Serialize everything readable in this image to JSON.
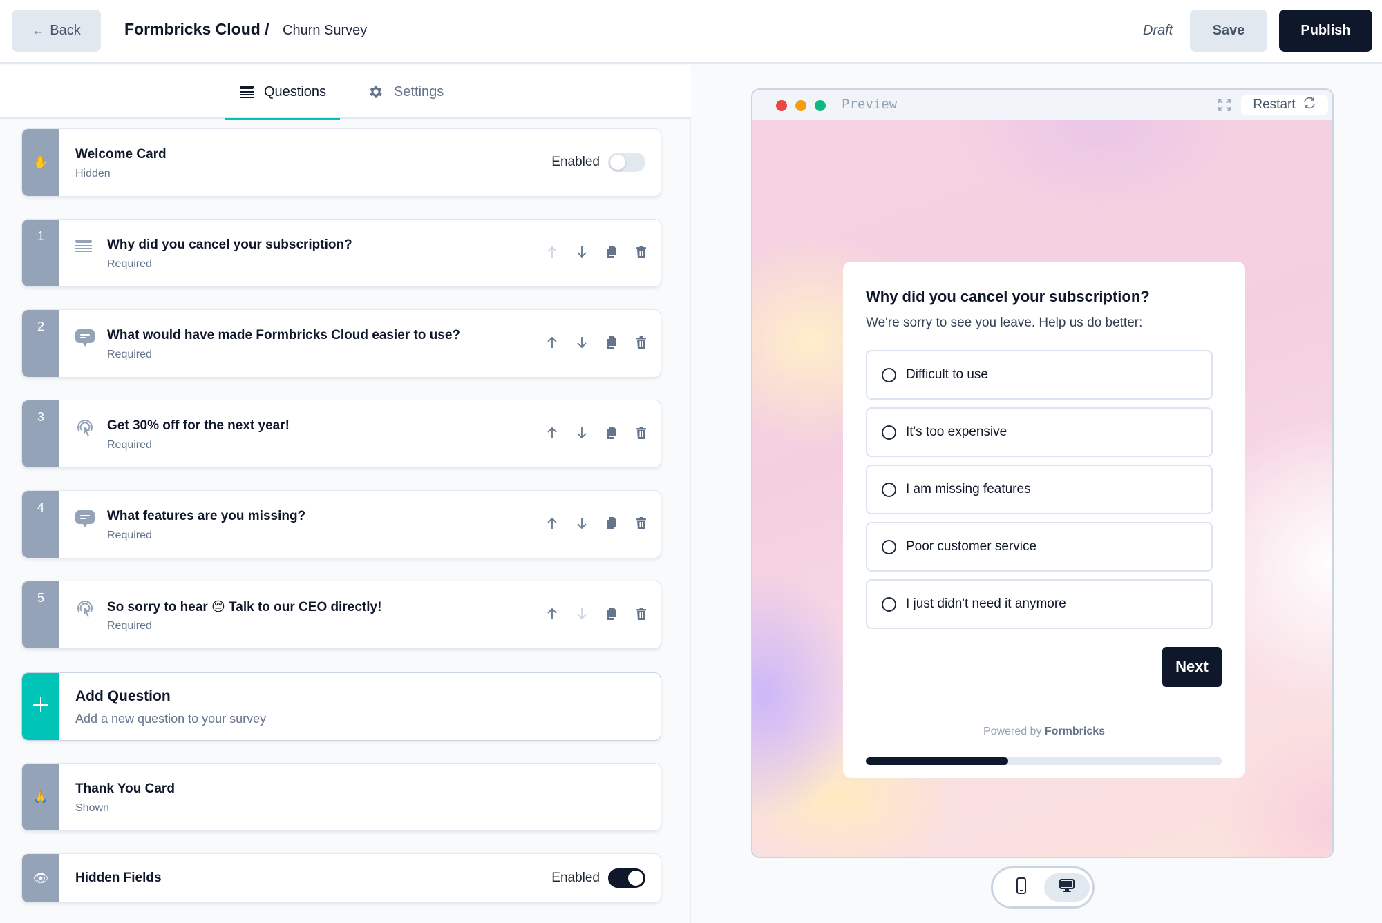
{
  "header": {
    "back_label": "Back",
    "brand": "Formbricks Cloud /",
    "survey_name": "Churn Survey",
    "status": "Draft",
    "save_label": "Save",
    "publish_label": "Publish"
  },
  "tabs": [
    {
      "label": "Questions",
      "icon": "list-icon",
      "active": true
    },
    {
      "label": "Settings",
      "icon": "gear-icon",
      "active": false
    }
  ],
  "welcome_card": {
    "icon": "✋",
    "title": "Welcome Card",
    "status": "Hidden",
    "toggle_label": "Enabled",
    "enabled": false
  },
  "questions": [
    {
      "number": "1",
      "type_icon": "list-lines-icon",
      "title": "Why did you cancel your subscription?",
      "status": "Required",
      "can_move_up": false,
      "can_move_down": true
    },
    {
      "number": "2",
      "type_icon": "chat-bubble-icon",
      "title": "What would have made Formbricks Cloud easier to use?",
      "status": "Required",
      "can_move_up": true,
      "can_move_down": true
    },
    {
      "number": "3",
      "type_icon": "cursor-click-icon",
      "title": "Get 30% off for the next year!",
      "status": "Required",
      "can_move_up": true,
      "can_move_down": true
    },
    {
      "number": "4",
      "type_icon": "chat-bubble-icon",
      "title": "What features are you missing?",
      "status": "Required",
      "can_move_up": true,
      "can_move_down": true
    },
    {
      "number": "5",
      "type_icon": "cursor-click-icon",
      "title": "So sorry to hear 😔 Talk to our CEO directly!",
      "status": "Required",
      "can_move_up": true,
      "can_move_down": false
    }
  ],
  "add_question": {
    "title": "Add Question",
    "subtitle": "Add a new question to your survey"
  },
  "thank_you_card": {
    "icon": "🙏",
    "title": "Thank You Card",
    "status": "Shown"
  },
  "hidden_fields": {
    "icon": "👁",
    "title": "Hidden Fields",
    "toggle_label": "Enabled",
    "enabled": true
  },
  "preview": {
    "window_title": "Preview",
    "restart_label": "Restart",
    "question": "Why did you cancel your subscription?",
    "subheader": "We're sorry to see you leave. Help us do better:",
    "choices": [
      "Difficult to use",
      "It's too expensive",
      "I am missing features",
      "Poor customer service",
      "I just didn't need it anymore"
    ],
    "next_label": "Next",
    "powered_by": "Powered by",
    "powered_brand": "Formbricks",
    "progress_percent": 40,
    "device_modes": [
      "mobile",
      "desktop"
    ],
    "active_device": "desktop"
  },
  "colors": {
    "brand_teal": "#00c4b8",
    "primary_dark": "#0f172a",
    "rail_gray": "#94a3b8",
    "dot_red": "#ef4444",
    "dot_amber": "#f59e0b",
    "dot_green": "#10b981"
  }
}
